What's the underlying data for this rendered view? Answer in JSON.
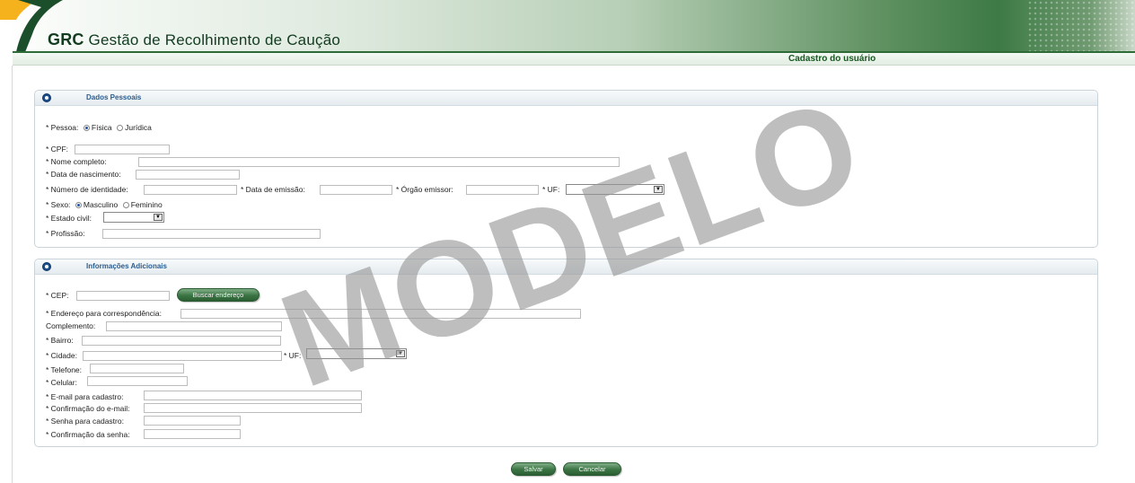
{
  "header": {
    "app_abbrev": "GRC",
    "app_name": "Gestão de Recolhimento de Caução",
    "page_name": "Cadastro do usuário"
  },
  "dados_pessoais": {
    "title": "Dados Pessoais",
    "pessoa_label": "* Pessoa:",
    "pessoa_options": [
      "Física",
      "Jurídica"
    ],
    "pessoa_selected": "Física",
    "cpf_label": "* CPF:",
    "nome_label": "* Nome completo:",
    "nascimento_label": "* Data de nascimento:",
    "identidade_label": "* Número de identidade:",
    "emissao_label": "* Data de emissão:",
    "orgao_label": "* Órgão emissor:",
    "uf_label": "* UF:",
    "sexo_label": "* Sexo:",
    "sexo_options": [
      "Masculino",
      "Feminino"
    ],
    "sexo_selected": "Masculino",
    "estado_civil_label": "* Estado civil:",
    "profissao_label": "* Profissão:"
  },
  "informacoes_adicionais": {
    "title": "Informações Adicionais",
    "cep_label": "* CEP:",
    "buscar_button": "Buscar endereço",
    "endereco_label": "* Endereço para correspondência:",
    "complemento_label": "Complemento:",
    "bairro_label": "* Bairro:",
    "cidade_label": "* Cidade:",
    "uf_label": "* UF:",
    "telefone_label": "* Telefone:",
    "celular_label": "* Celular:",
    "email_label": "* E-mail para cadastro:",
    "confirma_email_label": "* Confirmação do e-mail:",
    "senha_label": "* Senha para cadastro:",
    "confirma_senha_label": "* Confirmação da senha:"
  },
  "actions": {
    "save_label": "Salvar",
    "cancel_label": "Cancelar"
  },
  "watermark": "MODELO",
  "colors": {
    "brand_green": "#2f6b36",
    "panel_title_blue": "#2a5d8f",
    "page_name_green": "#15581f"
  },
  "icons": {
    "panel_toggle": "circle-toggle-icon",
    "select_arrow": "dropdown-arrow-icon"
  }
}
